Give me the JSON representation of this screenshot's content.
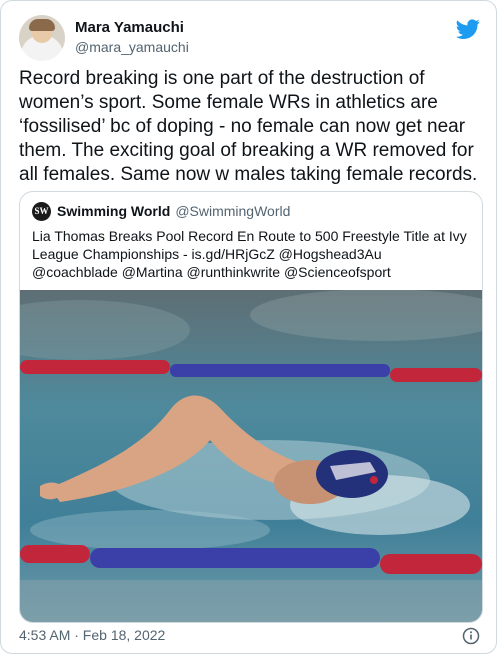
{
  "tweet": {
    "author_name": "Mara Yamauchi",
    "author_handle": "@mara_yamauchi",
    "text": "Record breaking is one part of the destruction of women’s sport. Some female WRs in athletics are ‘fossilised’ bc of doping - no female can now get near them. The exciting goal of breaking a WR removed for all females. Same now w males taking female records.",
    "timestamp": "4:53 AM · Feb 18, 2022"
  },
  "quoted": {
    "logo_text": "SW",
    "author_name": "Swimming World",
    "author_handle": "@SwimmingWorld",
    "text": "Lia Thomas Breaks Pool Record En Route to 500 Freestyle Title at Ivy League Championships - is.gd/HRjGcZ @Hogshead3Au @coachblade @Martina @runthinkwrite @Scienceofsport"
  },
  "icons": [
    "twitter-bird-icon",
    "info-icon"
  ],
  "colors": {
    "brand": "#1d9bf0",
    "muted": "#536471",
    "border": "#cfd9de"
  }
}
